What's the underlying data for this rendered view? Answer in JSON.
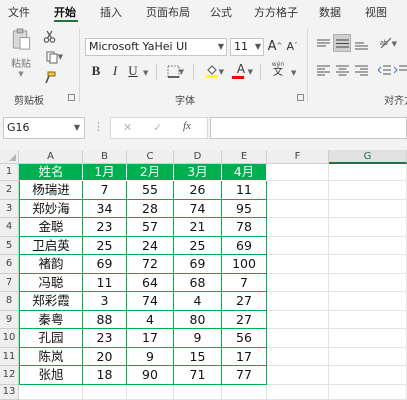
{
  "menu": {
    "tabs": [
      "文件",
      "开始",
      "插入",
      "页面布局",
      "公式",
      "方方格子",
      "数据",
      "视图"
    ],
    "active": "开始"
  },
  "ribbon": {
    "clipboard": {
      "paste_label": "粘贴",
      "group_label": "剪贴板"
    },
    "font": {
      "font_name": "Microsoft YaHei UI",
      "font_size": "11",
      "bold": "B",
      "italic": "I",
      "underline": "U",
      "group_label": "字体",
      "wen": "wén",
      "wen_char": "文",
      "grow": "A",
      "shrink": "A",
      "font_color_letter": "A",
      "fill_color": "#ffff00",
      "font_color": "#ff0000"
    },
    "alignment": {
      "group_label": "对齐方式"
    }
  },
  "formula_bar": {
    "name_box": "G16",
    "more": "⋮",
    "cancel": "✕",
    "enter": "✓",
    "fx": "fx",
    "value": ""
  },
  "grid": {
    "columns": [
      "A",
      "B",
      "C",
      "D",
      "E",
      "F",
      "G"
    ],
    "selected_column": "G",
    "rows": [
      [
        "姓名",
        "1月",
        "2月",
        "3月",
        "4月"
      ],
      [
        "杨瑞进",
        "7",
        "55",
        "26",
        "11"
      ],
      [
        "郑妙海",
        "34",
        "28",
        "74",
        "95"
      ],
      [
        "金聪",
        "23",
        "57",
        "21",
        "78"
      ],
      [
        "卫启英",
        "25",
        "24",
        "25",
        "69"
      ],
      [
        "褚韵",
        "69",
        "72",
        "69",
        "100"
      ],
      [
        "冯聪",
        "11",
        "64",
        "68",
        "7"
      ],
      [
        "郑彩霞",
        "3",
        "74",
        "4",
        "27"
      ],
      [
        "秦粤",
        "88",
        "4",
        "80",
        "27"
      ],
      [
        "孔园",
        "23",
        "17",
        "9",
        "56"
      ],
      [
        "陈岚",
        "20",
        "9",
        "15",
        "17"
      ],
      [
        "张旭",
        "18",
        "90",
        "71",
        "77"
      ]
    ],
    "row_numbers": [
      "1",
      "2",
      "3",
      "4",
      "5",
      "6",
      "7",
      "8",
      "9",
      "10",
      "11",
      "12",
      "13"
    ],
    "header_fill": "#00b050",
    "border_color": "#00b050"
  }
}
